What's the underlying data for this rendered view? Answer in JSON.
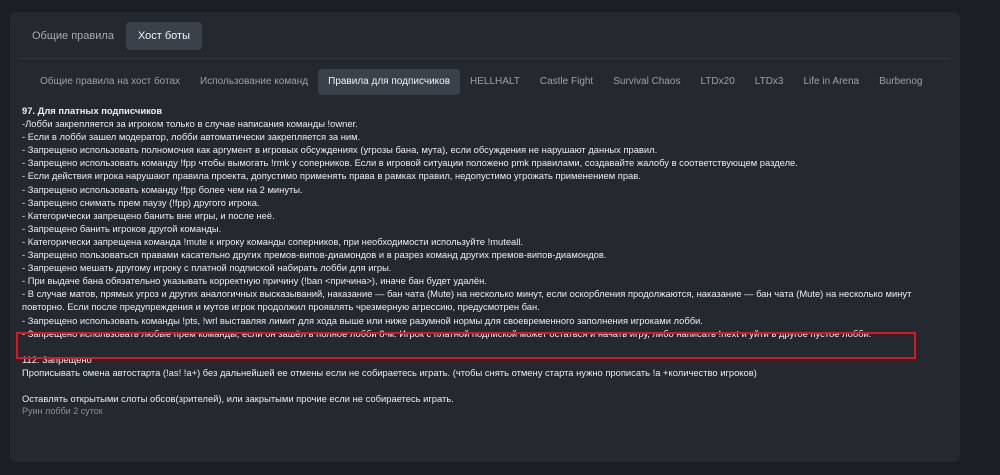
{
  "top_tabs": [
    {
      "label": "Общие правила",
      "active": false
    },
    {
      "label": "Хост боты",
      "active": true
    }
  ],
  "sub_tabs": [
    {
      "label": "Общие правила на хост ботах",
      "active": false
    },
    {
      "label": "Использование команд",
      "active": false
    },
    {
      "label": "Правила для подписчиков",
      "active": true
    },
    {
      "label": "HELLHALT",
      "active": false
    },
    {
      "label": "Castle Fight",
      "active": false
    },
    {
      "label": "Survival Chaos",
      "active": false
    },
    {
      "label": "LTDx20",
      "active": false
    },
    {
      "label": "LTDx3",
      "active": false
    },
    {
      "label": "Life in Arena",
      "active": false
    },
    {
      "label": "Burbenog",
      "active": false
    }
  ],
  "rule97": {
    "title": "97. Для платных подписчиков",
    "lines": [
      "-Лобби закрепляется за игроком только в случае написания команды !owner.",
      "- Если в лобби зашел модератор, лобби автоматически закрепляется за ним.",
      "- Запрещено использовать полномочия как аргумент в игровых обсуждениях (угрозы бана, мута), если обсуждения не нарушают данных правил.",
      "- Запрещено использовать команду !fpp чтобы вымогать !rmk у соперников. Если в игровой ситуации положено pmk правилами, создавайте жалобу в соответствующем разделе.",
      "- Если действия игрока нарушают правила проекта, допустимо применять права в рамках правил, недопустимо угрожать применением прав.",
      "- Запрещено использовать команду !fpp более чем на 2 минуты.",
      "- Запрещено снимать прем паузу (!fpp) другого игрока.",
      "- Категорически запрещено банить вне игры, и после неё.",
      "- Запрещено банить игроков другой команды.",
      "- Категорически запрещена команда !mute к игроку команды соперников, при необходимости используйте !muteall.",
      "- Запрещено пользоваться правами касательно других премов-випов-диамондов и в разрез команд других премов-випов-диамондов.",
      "- Запрещено мешать другому игроку с платной подпиской набирать лобби для игры.",
      "- При выдаче бана обязательно указывать корректную причину (!ban <причина>), иначе бан будет удалён."
    ],
    "line_mats": "- В случае матов, прямых угроз и других аналогичных высказываний, наказание — бан чата (Mute) на несколько минут, если оскорбления продолжаются, наказание — бан чата (Mute) на несколько минут повторно. Если после предупреждения и мутов игрок продолжил проявлять чрезмерную агрессию, предусмотрен бан.",
    "line_pts": "- Запрещено использовать команды !pts, !wrl выставляя лимит для хода выше или ниже разумной нормы для своевременного заполнения игроками лобби.",
    "line_highlight": "- Запрещено использовать любые прем команды, если он зашёл в полное лобби 8-м. Игрок с платной подпиской может остаться и начать игру, либо написать !next и уйти в другое пустое лобби."
  },
  "rule112": {
    "title": "112. Запрещено",
    "line1": "Прописывать омена автостарта (!as! !a+) без дальнейшей ее отмены если не собираетесь играть. (чтобы снять отмену старта нужно прописать !a +количество игроков)",
    "line2": "Оставлять открытыми слоты обсов(зрителей), или закрытыми прочие если не собираетесь играть.",
    "footer": "Руин лобби 2 суток"
  },
  "colors": {
    "highlight": "#e0141e",
    "active_tab": "#3b414b"
  }
}
